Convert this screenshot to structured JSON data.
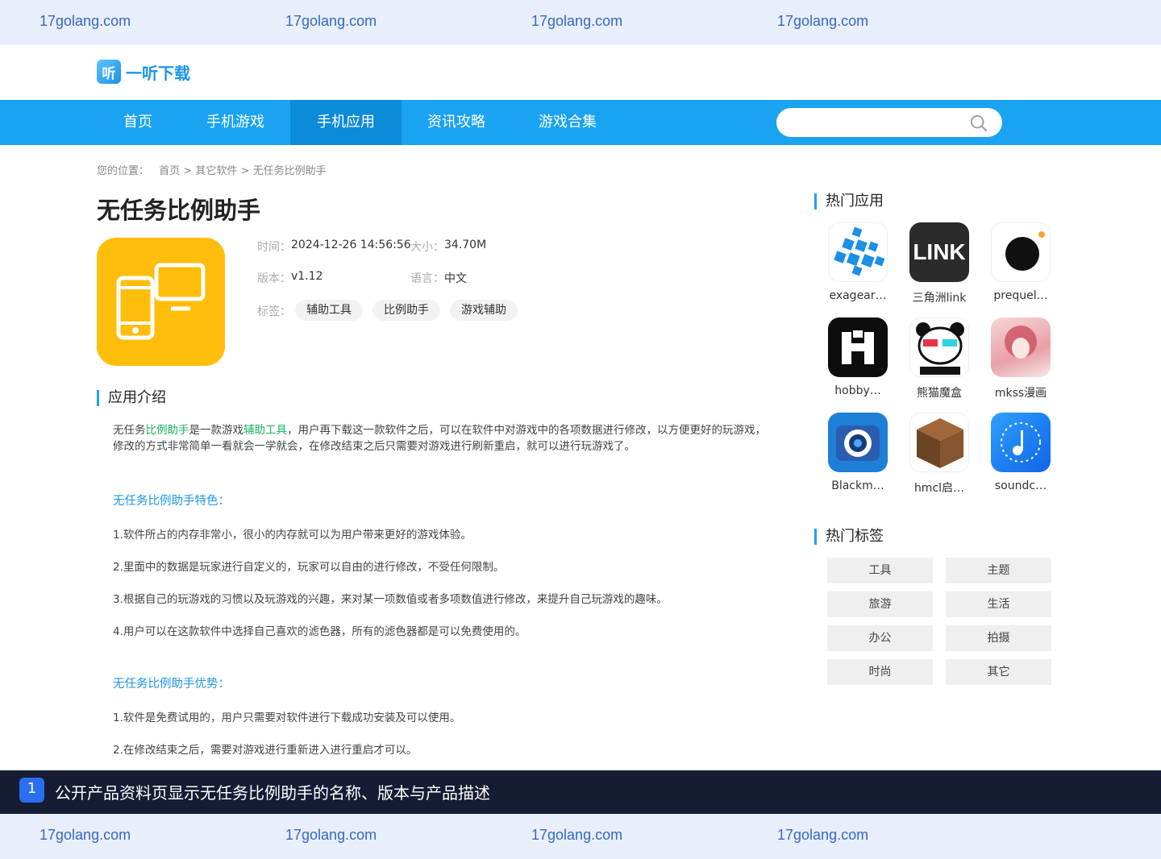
{
  "watermark": {
    "text": "17golang.com"
  },
  "logo": {
    "mark": "听",
    "name": "一听下载"
  },
  "nav": {
    "items": [
      "首页",
      "手机游戏",
      "手机应用",
      "资讯攻略",
      "游戏合集"
    ],
    "active": "手机应用",
    "search_placeholder": ""
  },
  "breadcrumb": {
    "label": "您的位置：",
    "home": "首页",
    "sep1": ">",
    "category": "其它软件",
    "sep2": ">",
    "current": "无任务比例助手"
  },
  "app": {
    "title": "无任务比例助手",
    "time_label": "时间：",
    "time": "2024-12-26 14:56:56",
    "size_label": "大小：",
    "size": "34.70M",
    "version_label": "版本：",
    "version": "v1.12",
    "lang_label": "语言：",
    "lang": "中文",
    "tags_label": "标签：",
    "tags": [
      "辅助工具",
      "比例助手",
      "游戏辅助"
    ]
  },
  "intro": {
    "heading": "应用介绍",
    "p_pre": "无任务",
    "p_link1": "比例助手",
    "p_mid": "是一款游戏",
    "p_link2": "辅助工具",
    "p_post": "，用户再下载这一款软件之后，可以在软件中对游戏中的各项数据进行修改，以方便更好的玩游戏，修改的方式非常简单一看就会一学就会，在修改结束之后只需要对游戏进行刷新重启，就可以进行玩游戏了。",
    "features_heading": "无任务比例助手特色：",
    "features": [
      "1.软件所占的内存非常小，很小的内存就可以为用户带来更好的游戏体验。",
      "2.里面中的数据是玩家进行自定义的，玩家可以自由的进行修改，不受任何限制。",
      "3.根据自己的玩游戏的习惯以及玩游戏的兴趣，来对某一项数值或者多项数值进行修改，来提升自己玩游戏的趣味。",
      "4.用户可以在这款软件中选择自己喜欢的滤色器，所有的滤色器都是可以免费使用的。"
    ],
    "advantages_heading": "无任务比例助手优势：",
    "advantages": [
      "1.软件是免费试用的，用户只需要对软件进行下载成功安装及可以使用。",
      "2.在修改结束之后，需要对游戏进行重新进入进行重启才可以。"
    ]
  },
  "sidebar": {
    "hot_apps_heading": "热门应用",
    "hot_apps": [
      "exagear…",
      "三角洲link",
      "prequel…",
      "hobby…",
      "熊猫魔盒",
      "mkss漫画",
      "Blackm…",
      "hmcl启…",
      "soundc…"
    ],
    "hot_tags_heading": "热门标签",
    "hot_tags": [
      "工具",
      "主题",
      "旅游",
      "生活",
      "办公",
      "拍摄",
      "时尚",
      "其它"
    ]
  },
  "banner": {
    "num": "1",
    "text": "公开产品资料页显示无任务比例助手的名称、版本与产品描述"
  },
  "colors": {
    "nav": "#1aa3f0",
    "nav_active": "#0c8bd8",
    "app_icon": "#ffbe0b",
    "banner": "#151c33"
  }
}
